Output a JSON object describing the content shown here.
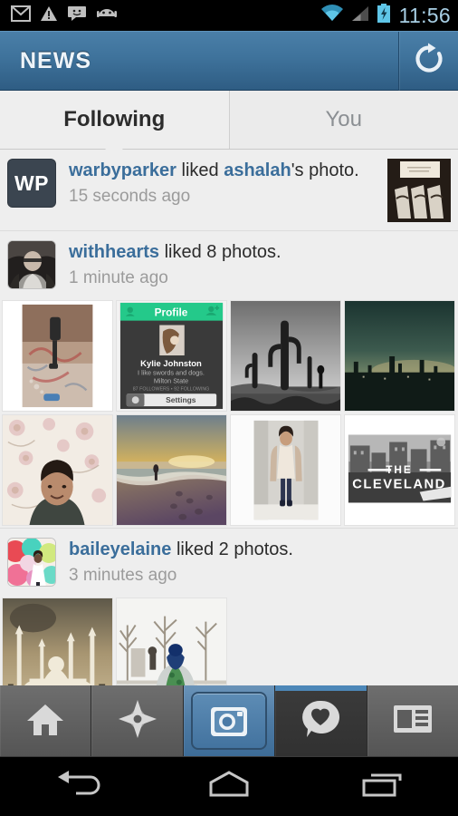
{
  "status_bar": {
    "icons": [
      "gmail-icon",
      "warning-icon",
      "chat-icon",
      "android-icon",
      "wifi-icon",
      "signal-icon",
      "battery-charging-icon"
    ],
    "time": "11:56",
    "time_color": "#a8cfe5"
  },
  "action_bar": {
    "title": "NEWS",
    "refresh_label": "refresh-icon",
    "accent": "#3f739c"
  },
  "tabs": [
    {
      "label": "Following",
      "selected": true
    },
    {
      "label": "You",
      "selected": false
    }
  ],
  "feed": {
    "stories": [
      {
        "avatar": {
          "type": "initials",
          "text": "WP",
          "bg": "#3b4550"
        },
        "actor": "warbyparker",
        "verb": " liked ",
        "target": "ashalah",
        "suffix": "'s photo.",
        "time": "15 seconds ago",
        "thumb": "eyeglasses-display-case-photo",
        "photos": []
      },
      {
        "avatar": {
          "type": "photo",
          "text": "portrait-man-with-glasses"
        },
        "actor": "withhearts",
        "verb": " liked ",
        "target": "",
        "suffix": "8 photos.",
        "time": "1 minute ago",
        "thumb": "",
        "photos": [
          "graffiti-wall-skater",
          "profile-app-screenshot",
          "black-and-white-cactus-desert",
          "dark-teal-city-skyline",
          "woman-floral-wallpaper-portrait",
          "beach-sunset-surfer-footprints",
          "woman-standing-in-hallway",
          "the-cleveland-rooftop-sign"
        ]
      },
      {
        "avatar": {
          "type": "photo",
          "text": "woman-with-colorful-balloons"
        },
        "actor": "baileyelaine",
        "verb": " liked ",
        "target": "",
        "suffix": "2 photos.",
        "time": "3 minutes ago",
        "thumb": "",
        "photos": [
          "sepia-mosque-minarets-silhouette",
          "winter-snow-patterned-coat-person"
        ]
      }
    ],
    "embedded_profile_card": {
      "header_title": "Profile",
      "name": "Kylie Johnston",
      "bio": "I like swords and dogs.",
      "location": "Milton State",
      "stats": "87 FOLLOWERS • 92 FOLLOWING",
      "button_label": "Settings",
      "accent": "#24c98a"
    },
    "embedded_photo_text": {
      "the": "THE",
      "cleveland": "CLEVELAND"
    }
  },
  "app_nav": [
    {
      "name": "home-icon",
      "active": false
    },
    {
      "name": "explore-compass-icon",
      "active": false
    },
    {
      "name": "camera-icon",
      "active": false,
      "camera": true
    },
    {
      "name": "news-heart-icon",
      "active": true
    },
    {
      "name": "feed-list-icon",
      "active": false
    }
  ],
  "system_nav": [
    {
      "name": "back-icon"
    },
    {
      "name": "home-icon"
    },
    {
      "name": "recents-icon"
    }
  ]
}
